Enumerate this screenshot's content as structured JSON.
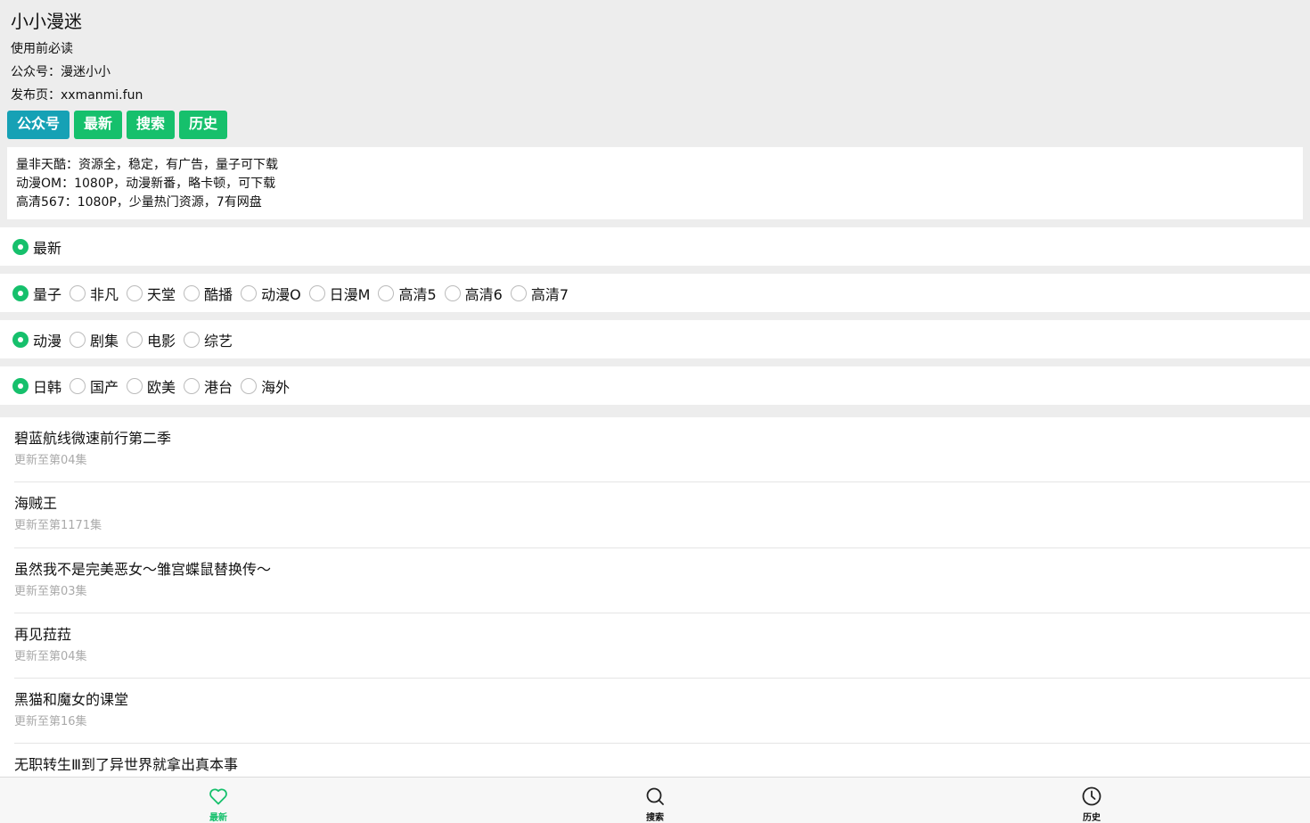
{
  "header": {
    "title": "小小漫迷",
    "lines": [
      "使用前必读",
      "公众号：漫迷小小",
      "发布页：xxmanmi.fun"
    ]
  },
  "buttons": [
    "公众号",
    "最新",
    "搜索",
    "历史"
  ],
  "notice": [
    "量非天酷：资源全，稳定，有广告，量子可下载",
    "动漫OM：1080P，动漫新番，略卡顿，可下载",
    "高清567：1080P，少量热门资源，7有网盘"
  ],
  "filters": {
    "mode": {
      "options": [
        "最新"
      ],
      "selected": 0
    },
    "source": {
      "options": [
        "量子",
        "非凡",
        "天堂",
        "酷播",
        "动漫O",
        "日漫M",
        "高清5",
        "高清6",
        "高清7"
      ],
      "selected": 0
    },
    "category": {
      "options": [
        "动漫",
        "剧集",
        "电影",
        "综艺"
      ],
      "selected": 0
    },
    "region": {
      "options": [
        "日韩",
        "国产",
        "欧美",
        "港台",
        "海外"
      ],
      "selected": 0
    }
  },
  "list": [
    {
      "title": "碧蓝航线微速前行第二季",
      "sub": "更新至第04集"
    },
    {
      "title": "海贼王",
      "sub": "更新至第1171集"
    },
    {
      "title": "虽然我不是完美恶女～雏宫蝶鼠替换传～",
      "sub": "更新至第03集"
    },
    {
      "title": "再见菈菈",
      "sub": "更新至第04集"
    },
    {
      "title": "黑猫和魔女的课堂",
      "sub": "更新至第16集"
    },
    {
      "title": "无职转生Ⅲ到了异世界就拿出真本事",
      "sub": ""
    }
  ],
  "tabbar": [
    {
      "label": "最新",
      "icon": "heart-icon",
      "active": true
    },
    {
      "label": "搜索",
      "icon": "search-icon",
      "active": false
    },
    {
      "label": "历史",
      "icon": "clock-icon",
      "active": false
    }
  ],
  "colors": {
    "accent": "#16c06c",
    "teal": "#16a1b5"
  }
}
